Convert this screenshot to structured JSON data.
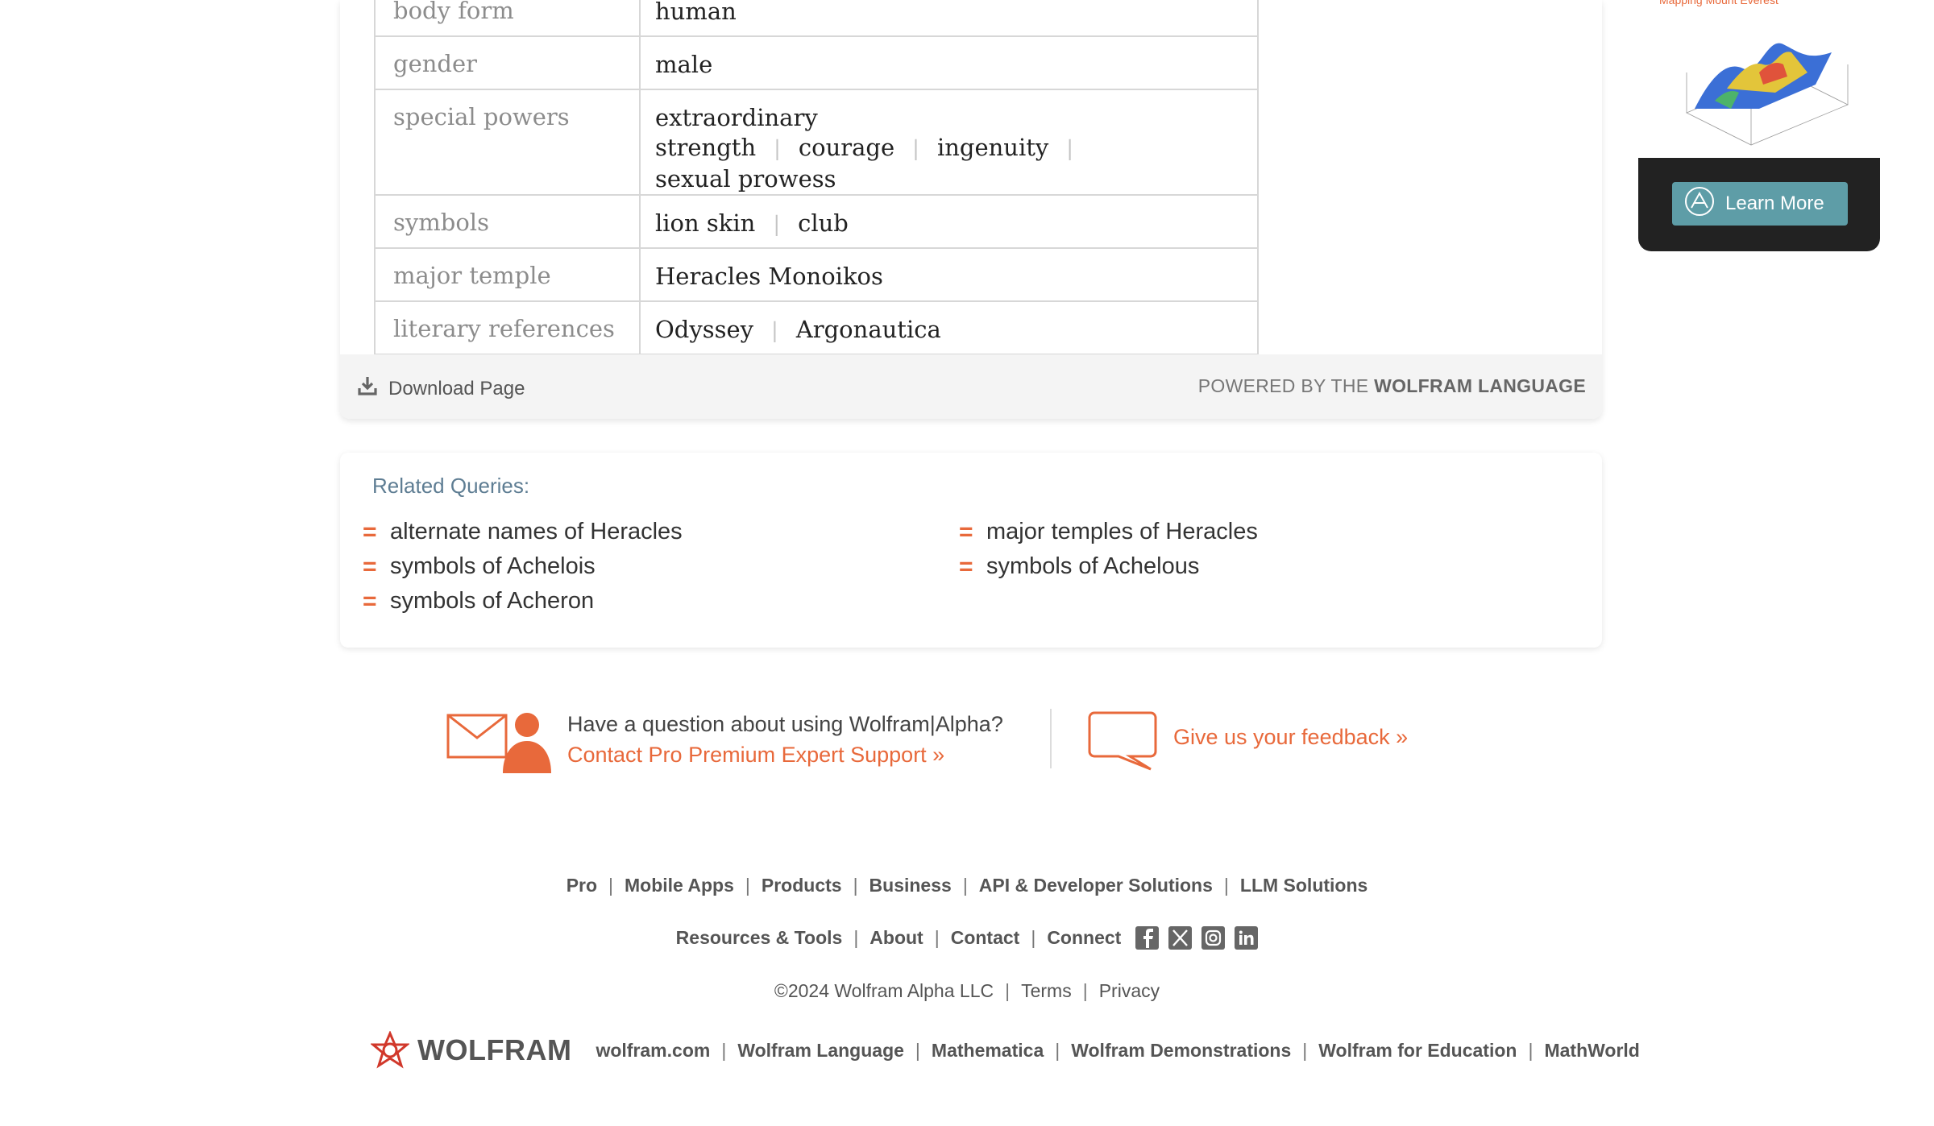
{
  "properties": [
    {
      "key": "body form",
      "values": [
        "human"
      ]
    },
    {
      "key": "gender",
      "values": [
        "male"
      ]
    },
    {
      "key": "special powers",
      "values": [
        "extraordinary strength",
        "courage",
        "ingenuity",
        "sexual prowess"
      ]
    },
    {
      "key": "symbols",
      "values": [
        "lion skin",
        "club"
      ]
    },
    {
      "key": "major temple",
      "values": [
        "Heracles Monoikos"
      ]
    },
    {
      "key": "literary references",
      "values": [
        "Odyssey",
        "Argonautica"
      ]
    }
  ],
  "separator": "|",
  "pod_footer": {
    "download_label": "Download Page",
    "powered_prefix": "POWERED BY THE",
    "powered_brand": "WOLFRAM LANGUAGE"
  },
  "related": {
    "title": "Related Queries:",
    "marker": "=",
    "items": [
      "alternate names of Heracles",
      "major temples of Heracles",
      "symbols of Achelois",
      "symbols of Achelous",
      "symbols of Acheron"
    ]
  },
  "support": {
    "question": "Have a question about using Wolfram|Alpha?",
    "contact_link": "Contact Pro Premium Expert Support »",
    "feedback_link": "Give us your feedback »"
  },
  "footer": {
    "row1": [
      "Pro",
      "Mobile Apps",
      "Products",
      "Business",
      "API & Developer Solutions",
      "LLM Solutions"
    ],
    "row2": [
      "Resources & Tools",
      "About",
      "Contact",
      "Connect"
    ],
    "social_icons": [
      "facebook-icon",
      "x-icon",
      "instagram-icon",
      "linkedin-icon"
    ],
    "copyright": "©2024  Wolfram Alpha LLC",
    "row3_links": [
      "Terms",
      "Privacy"
    ],
    "brand": "WOLFRAM",
    "row4": [
      "wolfram.com",
      "Wolfram Language",
      "Mathematica",
      "Wolfram Demonstrations",
      "Wolfram for Education",
      "MathWorld"
    ]
  },
  "ad": {
    "button_label": "Learn More",
    "caption": "Mapping Mount Everest"
  },
  "colors": {
    "accent_orange": "#e8693b",
    "related_title": "#5e7d93",
    "ad_button": "#5e9da7"
  }
}
